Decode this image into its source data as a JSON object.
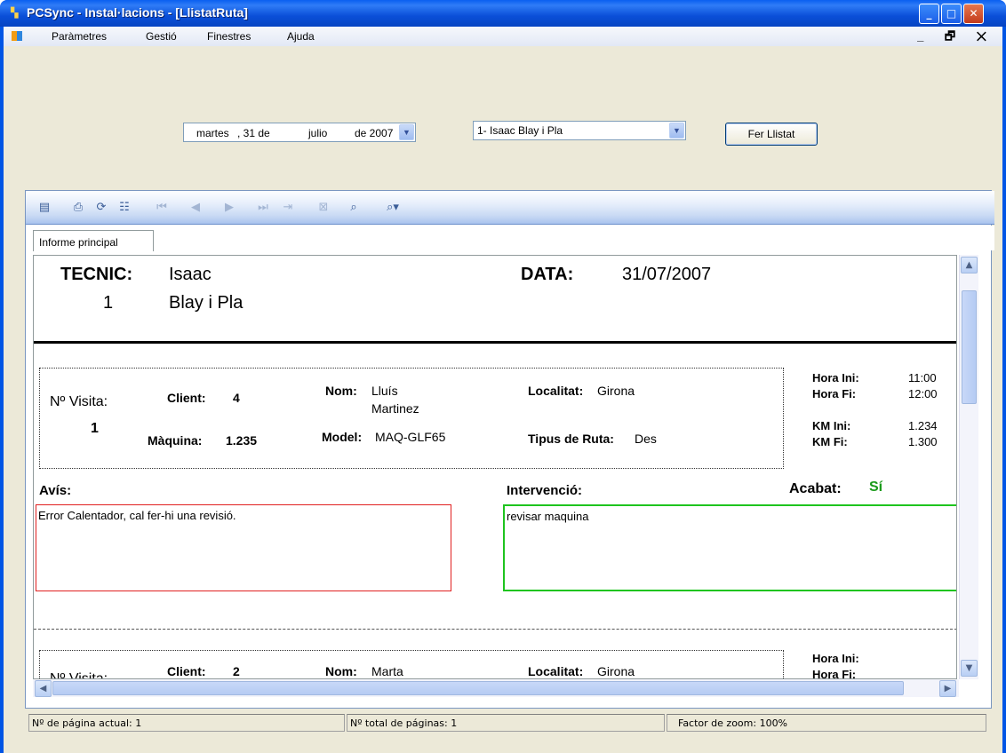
{
  "window": {
    "title": "PCSync - Instal·lacions - [LlistatRuta]",
    "minimize_glyph": "_",
    "maximize_glyph": "□",
    "close_glyph": "✕"
  },
  "menu": {
    "items": [
      "Paràmetres",
      "Gestió",
      "Finestres",
      "Ajuda"
    ],
    "mdi_controls": "_ 🗗 ✕"
  },
  "filters": {
    "date_weekday": "martes",
    "date_day": ", 31 de",
    "date_month": "julio",
    "date_year": "de 2007",
    "technician": "1- Isaac Blay i Pla",
    "run_button": "Fer Llistat"
  },
  "viewer": {
    "tab": "Informe principal",
    "toolbar_icons": [
      "export-icon",
      "print-icon",
      "refresh-icon",
      "group-tree-icon",
      "first-page-icon",
      "previous-page-icon",
      "next-page-icon",
      "last-page-icon",
      "go-to-page-icon",
      "stop-icon",
      "search-icon",
      "zoom-icon"
    ]
  },
  "report": {
    "header": {
      "tecnic_label": "TECNIC:",
      "tecnic_num": "1",
      "tecnic_first": "Isaac",
      "tecnic_last": "Blay i Pla",
      "data_label": "DATA:",
      "data_value": "31/07/2007"
    },
    "visits": [
      {
        "visita_label": "Nº Visita:",
        "visita_num": "1",
        "client_label": "Client:",
        "client_value": "4",
        "nom_label": "Nom:",
        "nom_value_1": "Lluís",
        "nom_value_2": "Martinez",
        "localitat_label": "Localitat:",
        "localitat_value": "Girona",
        "maquina_label": "Màquina:",
        "maquina_value": "1.235",
        "model_label": "Model:",
        "model_value": "MAQ-GLF65",
        "ruta_label": "Tipus de Ruta:",
        "ruta_value": "Des",
        "hora_ini_label": "Hora Ini:",
        "hora_ini": "11:00",
        "hora_fi_label": "Hora Fi:",
        "hora_fi": "12:00",
        "km_ini_label": "KM Ini:",
        "km_ini": "1.234",
        "km_fi_label": "KM Fi:",
        "km_fi": "1.300",
        "avis_label": "Avís:",
        "avis_text": "Error Calentador, cal fer-hi una revisió.",
        "intervencio_label": "Intervenció:",
        "intervencio_text": "revisar maquina",
        "acabat_label": "Acabat:",
        "acabat_value": "Sí"
      },
      {
        "visita_label": "Nº Visita:",
        "client_label": "Client:",
        "client_value": "2",
        "nom_label": "Nom:",
        "nom_value_1": "Marta",
        "localitat_label": "Localitat:",
        "localitat_value": "Girona",
        "hora_ini_label": "Hora Ini:",
        "hora_fi_label": "Hora Fi:"
      }
    ]
  },
  "status": {
    "current_page": "Nº de página actual: 1",
    "total_pages": "Nº total de páginas: 1",
    "zoom": "Factor de zoom: 100%"
  },
  "colors": {
    "titlebar": "#0a4fd8",
    "avis_border": "#e02020",
    "intervencio_border": "#1fc41f",
    "acabat_value": "#1a9a1a"
  }
}
